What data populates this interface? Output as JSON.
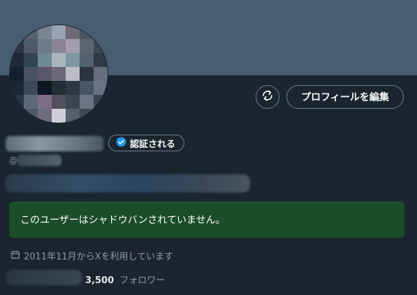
{
  "profile": {
    "edit_button": "プロフィールを編集",
    "verified_badge": "認証される",
    "handle_prefix": "@",
    "shadowban_status": "このユーザーはシャドウバンされていません。",
    "joined": "2011年11月からXを利用しています",
    "followers_count": "3,500",
    "followers_label": "フォロワー"
  },
  "icons": {
    "refresh": "refresh-icon",
    "verified": "verified-check-icon",
    "calendar": "calendar-icon"
  },
  "colors": {
    "banner": "#485d6f",
    "background": "#1b2530",
    "status_banner": "#1b4d2b",
    "verified_blue": "#1d9bf0"
  }
}
